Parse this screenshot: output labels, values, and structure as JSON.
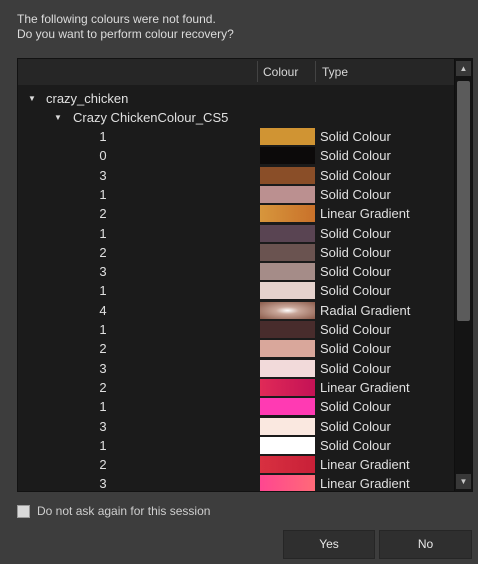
{
  "message": {
    "line1": "The following colours were not found.",
    "line2": "Do you want to perform colour recovery?"
  },
  "tree": {
    "columns": {
      "colour": "Colour",
      "type": "Type"
    },
    "root_label": "crazy_chicken",
    "palette_label": "Crazy ChickenColour_CS5",
    "rows": [
      {
        "count": "1",
        "swatch": "#d09433",
        "swatch2": "#d09433",
        "type": "Solid Colour"
      },
      {
        "count": "0",
        "swatch": "#0c0a0a",
        "swatch2": "#0c0a0a",
        "type": "Solid Colour"
      },
      {
        "count": "3",
        "swatch": "#8a4e28",
        "swatch2": "#8a4e28",
        "type": "Solid Colour"
      },
      {
        "count": "1",
        "swatch": "#bb9090",
        "swatch2": "#bb9090",
        "type": "Solid Colour"
      },
      {
        "count": "2",
        "swatch": "#d7963c",
        "swatch2": "#c9712a",
        "type": "Linear Gradient"
      },
      {
        "count": "1",
        "swatch": "#594452",
        "swatch2": "#594452",
        "type": "Solid Colour"
      },
      {
        "count": "2",
        "swatch": "#6a5350",
        "swatch2": "#6a5350",
        "type": "Solid Colour"
      },
      {
        "count": "3",
        "swatch": "#a58c88",
        "swatch2": "#a58c88",
        "type": "Solid Colour"
      },
      {
        "count": "1",
        "swatch": "#e5d2cd",
        "swatch2": "#e5d2cd",
        "type": "Solid Colour"
      },
      {
        "count": "4",
        "swatch": "#ffffff",
        "swatch2": "#8a5a4a",
        "type": "Radial Gradient"
      },
      {
        "count": "1",
        "swatch": "#482c2c",
        "swatch2": "#482c2c",
        "type": "Solid Colour"
      },
      {
        "count": "2",
        "swatch": "#d9a79b",
        "swatch2": "#d9a79b",
        "type": "Solid Colour"
      },
      {
        "count": "3",
        "swatch": "#f2dada",
        "swatch2": "#f2dada",
        "type": "Solid Colour"
      },
      {
        "count": "2",
        "swatch": "#e02a57",
        "swatch2": "#c41256",
        "type": "Linear Gradient"
      },
      {
        "count": "1",
        "swatch": "#ff3ab3",
        "swatch2": "#ff3ab3",
        "type": "Solid Colour"
      },
      {
        "count": "3",
        "swatch": "#fae8e0",
        "swatch2": "#fae8e0",
        "type": "Solid Colour"
      },
      {
        "count": "1",
        "swatch": "#ffffff",
        "swatch2": "#ffffff",
        "type": "Solid Colour"
      },
      {
        "count": "2",
        "swatch": "#d83040",
        "swatch2": "#c82038",
        "type": "Linear Gradient"
      },
      {
        "count": "3",
        "swatch": "#ff4690",
        "swatch2": "#ff6a78",
        "type": "Linear Gradient"
      }
    ]
  },
  "checkbox_label": "Do not ask again for this session",
  "buttons": {
    "yes": "Yes",
    "no": "No"
  }
}
